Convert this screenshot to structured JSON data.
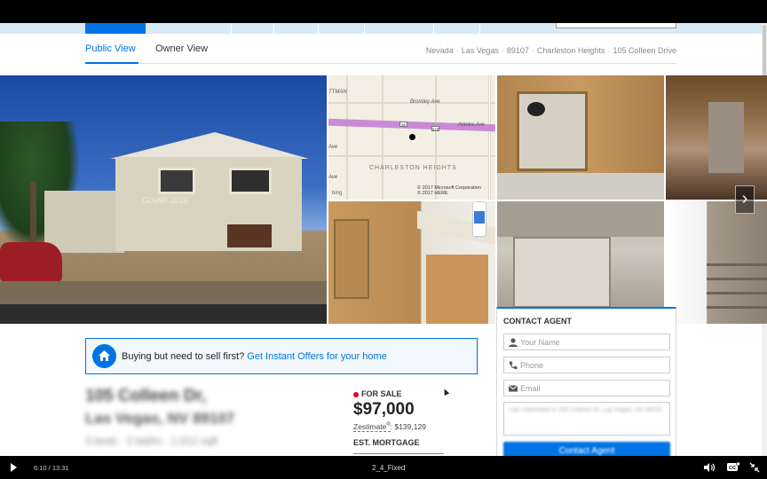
{
  "tabs": {
    "public": "Public View",
    "owner": "Owner View"
  },
  "breadcrumb": [
    "Nevada",
    "Las Vegas",
    "89107",
    "Charleston Heights",
    "105 Colleen Drive"
  ],
  "gallery": {
    "watermark": "GLVAR 2016",
    "map": {
      "streets": [
        "Bromley Ave",
        "Alaska Ave",
        "Ave",
        "Ave"
      ],
      "highway_shields": [
        "93",
        "579"
      ],
      "area_label": "CHARLESTON HEIGHTS",
      "copyright": "© 2017 Microsoft Corporation",
      "copyright2": "© 2017 HERE",
      "provider": "bing",
      "top_label": "TTMAN"
    }
  },
  "banner": {
    "text": "Buying but need to sell first?",
    "link": "Get Instant Offers for your home"
  },
  "address": {
    "line1": "105 Colleen Dr,",
    "line2": "Las Vegas, NV 89107",
    "line3": "3 beds · 2 baths · 1,512 sqft"
  },
  "sale": {
    "status": "FOR SALE",
    "price": "$97,000",
    "zestimate_label": "Zestimate",
    "zestimate_sup": "®",
    "zestimate_value": ": $139,129",
    "est_mortgage": "EST. MORTGAGE"
  },
  "contact": {
    "title": "CONTACT AGENT",
    "name_placeholder": "Your Name",
    "phone_placeholder": "Phone",
    "email_placeholder": "Email",
    "message": "I am interested in 105 Colleen Dr, Las Vegas, NV 89107.",
    "button": "Contact Agent"
  },
  "player": {
    "time": "6:10 / 13:31",
    "title": "2_4_Fixed"
  },
  "colors": {
    "accent": "#0074e4",
    "for_sale_dot": "#e4002b"
  }
}
